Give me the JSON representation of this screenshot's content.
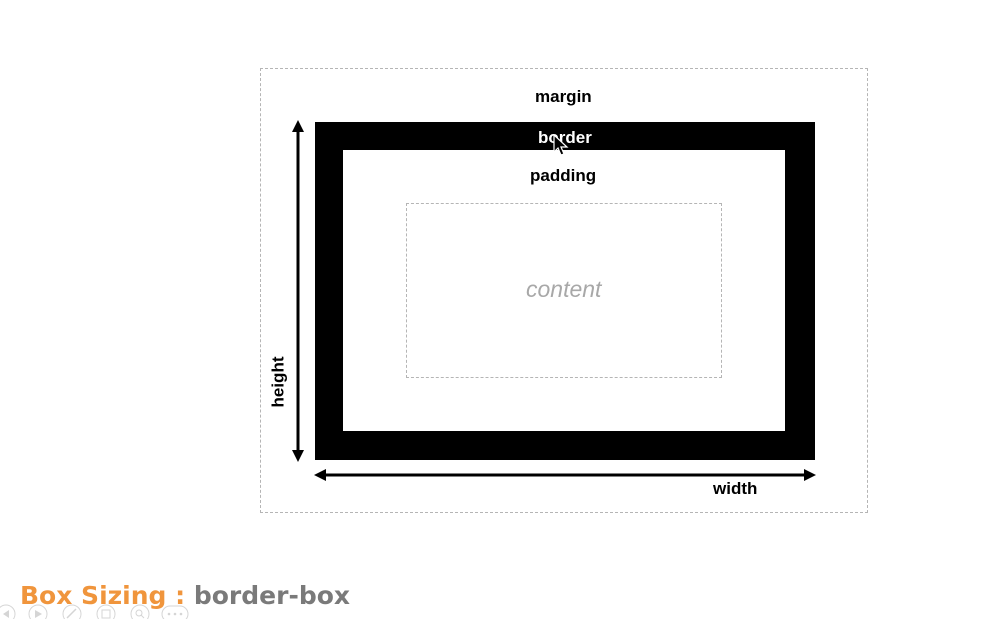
{
  "diagram": {
    "labels": {
      "margin": "margin",
      "border": "border",
      "padding": "padding",
      "content": "content",
      "width": "width",
      "height": "height"
    },
    "colors": {
      "border_fill": "#000000",
      "dashed_outline": "#b5b5b5",
      "content_text": "#a8a8a8"
    }
  },
  "title": {
    "lead": "Box Sizing",
    "separator": " : ",
    "value": "border-box",
    "lead_color": "#f0953c",
    "value_color": "#7a7a7a"
  },
  "player_controls": {
    "icons": [
      "previous-icon",
      "play-icon",
      "edit-icon",
      "save-icon",
      "zoom-icon",
      "more-icon"
    ]
  }
}
